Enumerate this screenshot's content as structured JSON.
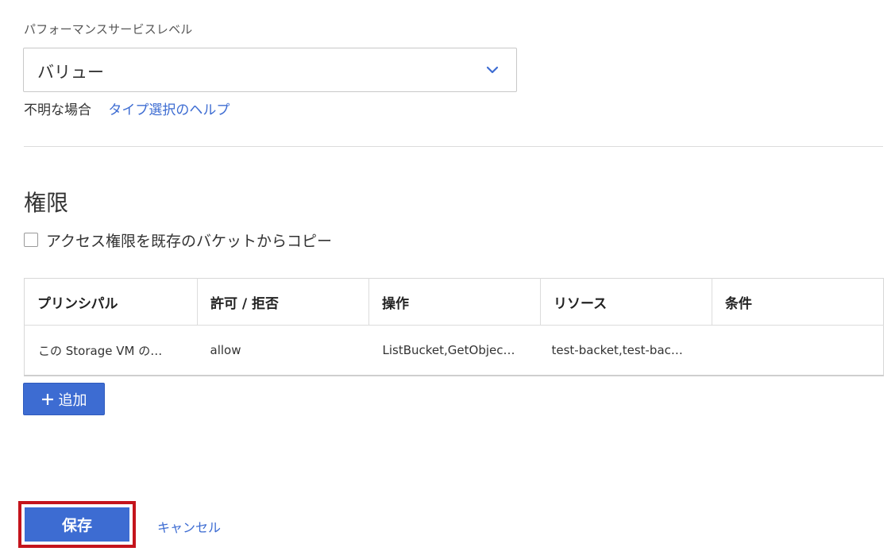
{
  "service_level": {
    "label": "パフォーマンスサービスレベル",
    "selected": "バリュー"
  },
  "help": {
    "prefix": "不明な場合",
    "link": "タイプ選択のヘルプ"
  },
  "permissions": {
    "title": "権限",
    "copy_checkbox_label": "アクセス権限を既存のバケットからコピー",
    "copy_checkbox_checked": false,
    "columns": [
      "プリンシパル",
      "許可 / 拒否",
      "操作",
      "リソース",
      "条件"
    ],
    "rows": [
      [
        "この Storage VM の…",
        "allow",
        "ListBucket,GetObjec…",
        "test-backet,test-bac…",
        ""
      ]
    ],
    "add_button": "追加"
  },
  "footer": {
    "save_label": "保存",
    "cancel_label": "キャンセル"
  },
  "colors": {
    "accent": "#3d6cd2",
    "highlight": "#c4141c"
  }
}
